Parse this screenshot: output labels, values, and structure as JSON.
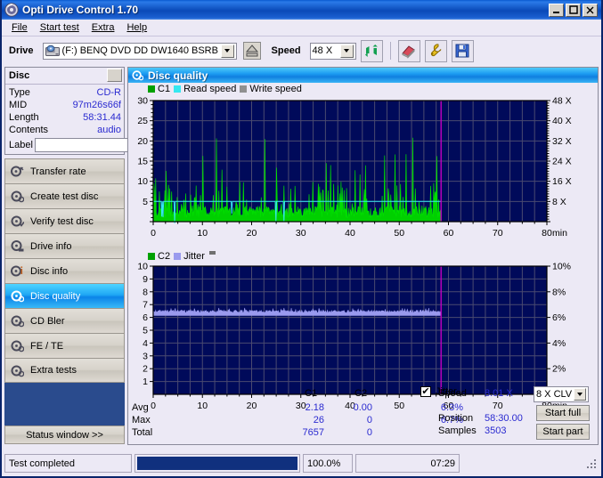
{
  "window": {
    "title": "Opti Drive Control 1.70",
    "icon": "disc-icon",
    "buttons": {
      "minimize": "_",
      "maximize": "☐",
      "close": "✕"
    }
  },
  "menu": [
    {
      "label": "File",
      "accel": "F"
    },
    {
      "label": "Start test",
      "accel": "S"
    },
    {
      "label": "Extra",
      "accel": "x"
    },
    {
      "label": "Help",
      "accel": "H"
    }
  ],
  "toolbar": {
    "drive_label": "Drive",
    "drive_value": "(F:)   BENQ DVD DD DW1640 BSRB",
    "eject_icon": "eject-icon",
    "speed_label": "Speed",
    "speed_value": "48 X",
    "refresh_icon": "refresh-icon",
    "erase_icon": "eraser-icon",
    "tools_icon": "wrench-icon",
    "save_icon": "save-icon"
  },
  "disc": {
    "title": "Disc",
    "fields": [
      {
        "key": "Type",
        "value": "CD-R"
      },
      {
        "key": "MID",
        "value": "97m26s66f"
      },
      {
        "key": "Length",
        "value": "58:31.44"
      },
      {
        "key": "Contents",
        "value": "audio"
      }
    ],
    "label_key": "Label",
    "label_value": "",
    "label_placeholder": ""
  },
  "nav": {
    "items": [
      {
        "id": "transfer-rate",
        "label": "Transfer rate",
        "active": false
      },
      {
        "id": "create-test-disc",
        "label": "Create test disc",
        "active": false
      },
      {
        "id": "verify-test-disc",
        "label": "Verify test disc",
        "active": false
      },
      {
        "id": "drive-info",
        "label": "Drive info",
        "active": false
      },
      {
        "id": "disc-info",
        "label": "Disc info",
        "active": false
      },
      {
        "id": "disc-quality",
        "label": "Disc quality",
        "active": true
      },
      {
        "id": "cd-bler",
        "label": "CD Bler",
        "active": false
      },
      {
        "id": "fe-te",
        "label": "FE / TE",
        "active": false
      },
      {
        "id": "extra-tests",
        "label": "Extra tests",
        "active": false
      }
    ],
    "status_window": "Status window >>"
  },
  "panel": {
    "title": "Disc quality",
    "icon": "disc-quality-icon"
  },
  "chart_data": [
    {
      "type": "line",
      "id": "c1-chart",
      "title": "",
      "legend": [
        {
          "label": "C1",
          "color": "#00a000"
        },
        {
          "label": "Read speed",
          "color": "#35e8f0"
        },
        {
          "label": "Write speed",
          "color": "#909090"
        }
      ],
      "legend_position": "top-left",
      "xlabel": "min",
      "x": [
        0,
        10,
        20,
        30,
        40,
        50,
        60,
        70,
        80
      ],
      "xlim": [
        0,
        80
      ],
      "ylabel": "",
      "ylim": [
        0,
        30
      ],
      "yticks": [
        5,
        10,
        15,
        20,
        25,
        30
      ],
      "y2label": "X",
      "y2lim": [
        0,
        48
      ],
      "y2ticks": [
        8,
        16,
        24,
        32,
        40,
        48
      ],
      "y2ticklabels": [
        "8 X",
        "16 X",
        "24 X",
        "32 X",
        "40 X",
        "48 X"
      ],
      "grid": true,
      "plot_bg": "#000a5a",
      "data_end_x": 58.5,
      "end_marker_color": "#c000c0",
      "series": [
        {
          "name": "C1",
          "color": "#00e000",
          "fill": "#00d000",
          "avg": 2.18,
          "max": 26
        },
        {
          "name": "Read speed",
          "color": "#35e8f0",
          "constant_y2": 8.01
        }
      ]
    },
    {
      "type": "line",
      "id": "c2-jitter-chart",
      "title": "",
      "legend": [
        {
          "label": "C2",
          "color": "#00a000"
        },
        {
          "label": "Jitter",
          "color": "#9a9aee"
        }
      ],
      "legend_position": "top-left",
      "xlabel": "min",
      "x": [
        0,
        10,
        20,
        30,
        40,
        50,
        60,
        70,
        80
      ],
      "xlim": [
        0,
        80
      ],
      "ylim": [
        0,
        10
      ],
      "yticks": [
        1,
        2,
        3,
        4,
        5,
        6,
        7,
        8,
        9,
        10
      ],
      "y2lim": [
        0,
        10
      ],
      "y2ticks": [
        2,
        4,
        6,
        8,
        10
      ],
      "y2ticklabels": [
        "2%",
        "4%",
        "6%",
        "8%",
        "10%"
      ],
      "grid": true,
      "plot_bg": "#000a5a",
      "data_end_x": 58.5,
      "end_marker_color": "#c000c0",
      "series": [
        {
          "name": "C2",
          "color": "#00e000",
          "avg": 0.0,
          "max": 0
        },
        {
          "name": "Jitter",
          "color": "#9a9aee",
          "avg_pct": 6.3,
          "max_pct": 6.7
        }
      ]
    }
  ],
  "stats": {
    "col_headers": [
      "",
      "C1",
      "C2"
    ],
    "jitter_checkbox": {
      "label": "Jitter",
      "checked": true,
      "mark": "✔"
    },
    "rows": [
      {
        "label": "Avg",
        "c1": "2.18",
        "c2": "0.00",
        "jitter": "6.3%"
      },
      {
        "label": "Max",
        "c1": "26",
        "c2": "0",
        "jitter": "6.7%"
      },
      {
        "label": "Total",
        "c1": "7657",
        "c2": "0",
        "jitter": ""
      }
    ],
    "right": {
      "speed_key": "Speed",
      "speed_value": "8.01 X",
      "position_key": "Position",
      "position_value": "58:30.00",
      "samples_key": "Samples",
      "samples_value": "3503",
      "mode_value": "8 X CLV",
      "start_full": "Start full",
      "start_part": "Start part"
    }
  },
  "statusbar": {
    "message": "Test completed",
    "progress_percent": 100,
    "percent_text": "100.0%",
    "time": "07:29"
  }
}
